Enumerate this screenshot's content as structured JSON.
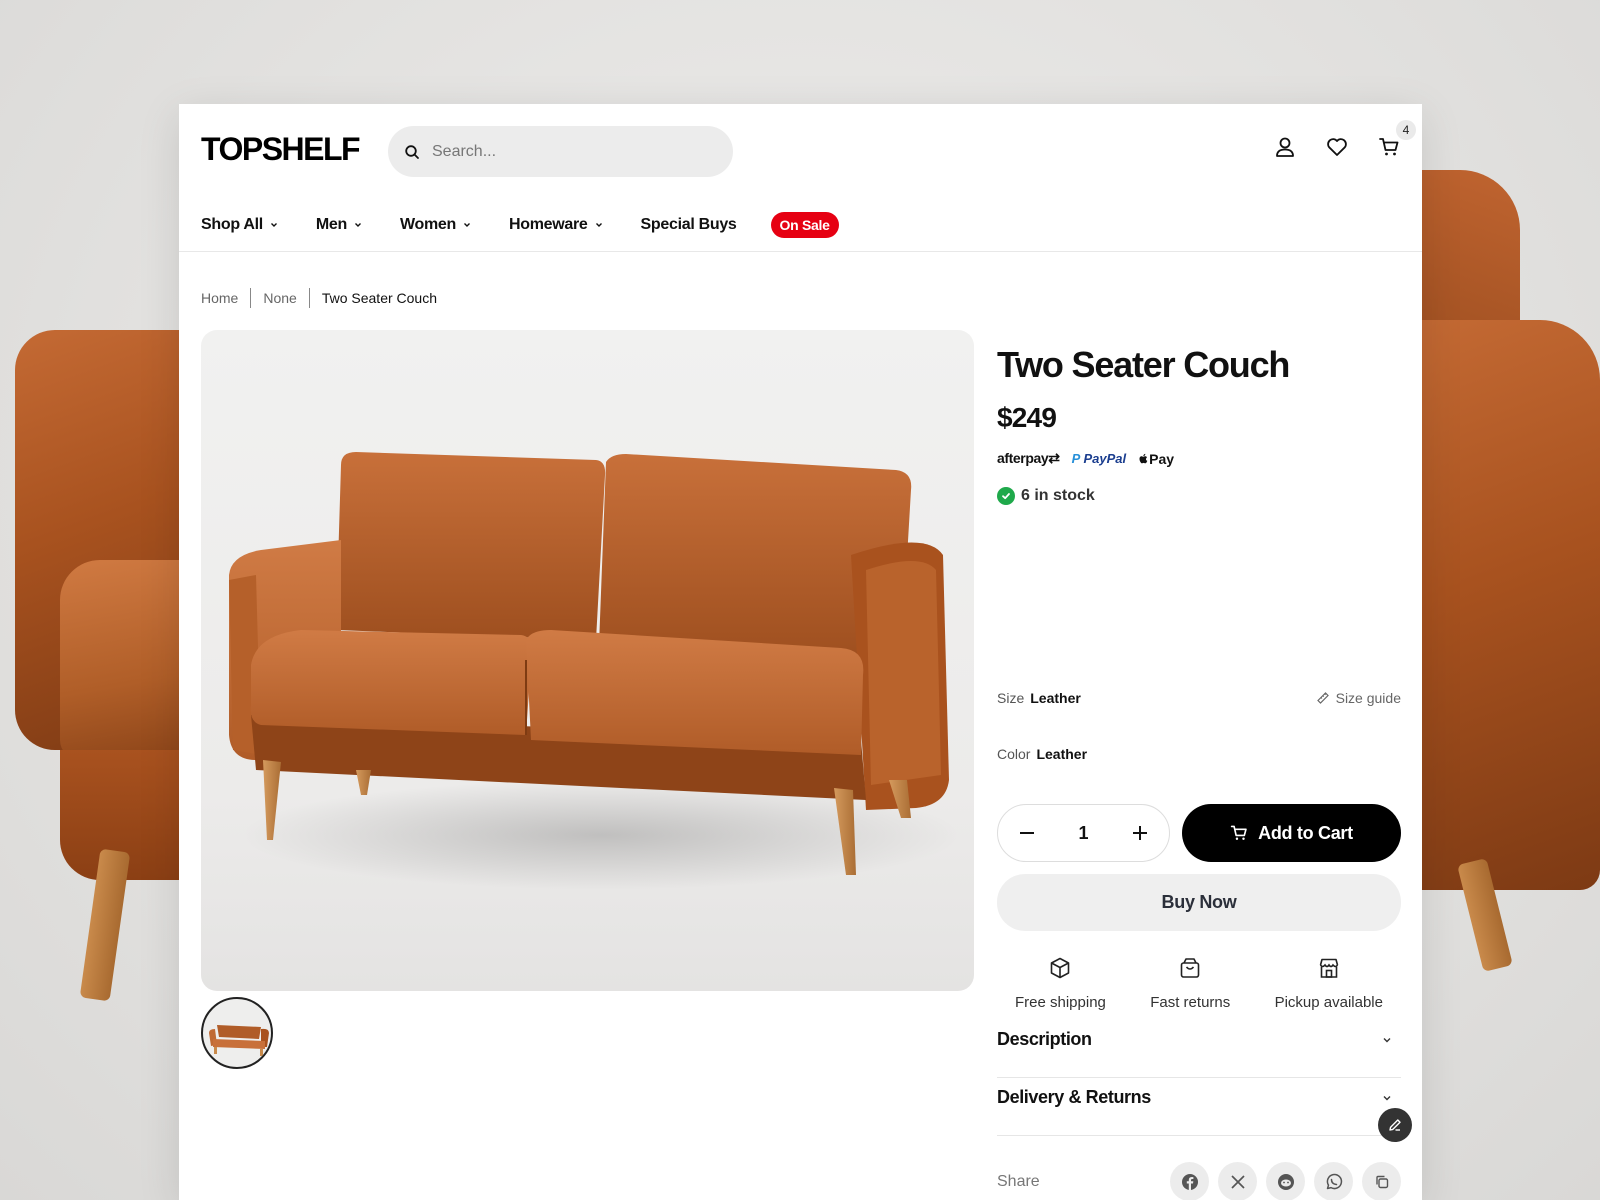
{
  "brand": {
    "logo": "TOPSHELF"
  },
  "search": {
    "placeholder": "Search..."
  },
  "header": {
    "cart_count": "4"
  },
  "nav": {
    "items": [
      {
        "label": "Shop All",
        "has_dropdown": true
      },
      {
        "label": "Men",
        "has_dropdown": true
      },
      {
        "label": "Women",
        "has_dropdown": true
      },
      {
        "label": "Homeware",
        "has_dropdown": true
      },
      {
        "label": "Special Buys",
        "has_dropdown": false
      }
    ],
    "sale_badge": "On Sale"
  },
  "breadcrumb": {
    "home": "Home",
    "category": "None",
    "current": "Two Seater Couch"
  },
  "product": {
    "title": "Two Seater Couch",
    "price": "$249",
    "payments": {
      "afterpay": "afterpay",
      "paypal_p": "P",
      "paypal": "PayPal",
      "apple_pay": "Pay"
    },
    "stock": "6 in stock",
    "size_label": "Size",
    "size_value": "Leather",
    "size_guide": "Size guide",
    "color_label": "Color",
    "color_value": "Leather",
    "quantity": "1",
    "add_to_cart": "Add to Cart",
    "buy_now": "Buy Now",
    "features": [
      {
        "label": "Free shipping",
        "icon": "box-icon"
      },
      {
        "label": "Fast returns",
        "icon": "bag-icon"
      },
      {
        "label": "Pickup available",
        "icon": "store-icon"
      }
    ],
    "accordions": [
      {
        "label": "Description"
      },
      {
        "label": "Delivery & Returns"
      }
    ],
    "share_label": "Share"
  },
  "colors": {
    "sale": "#e60012",
    "in_stock": "#1fa94b",
    "primary_button": "#000000",
    "leather": "#b35d29"
  }
}
